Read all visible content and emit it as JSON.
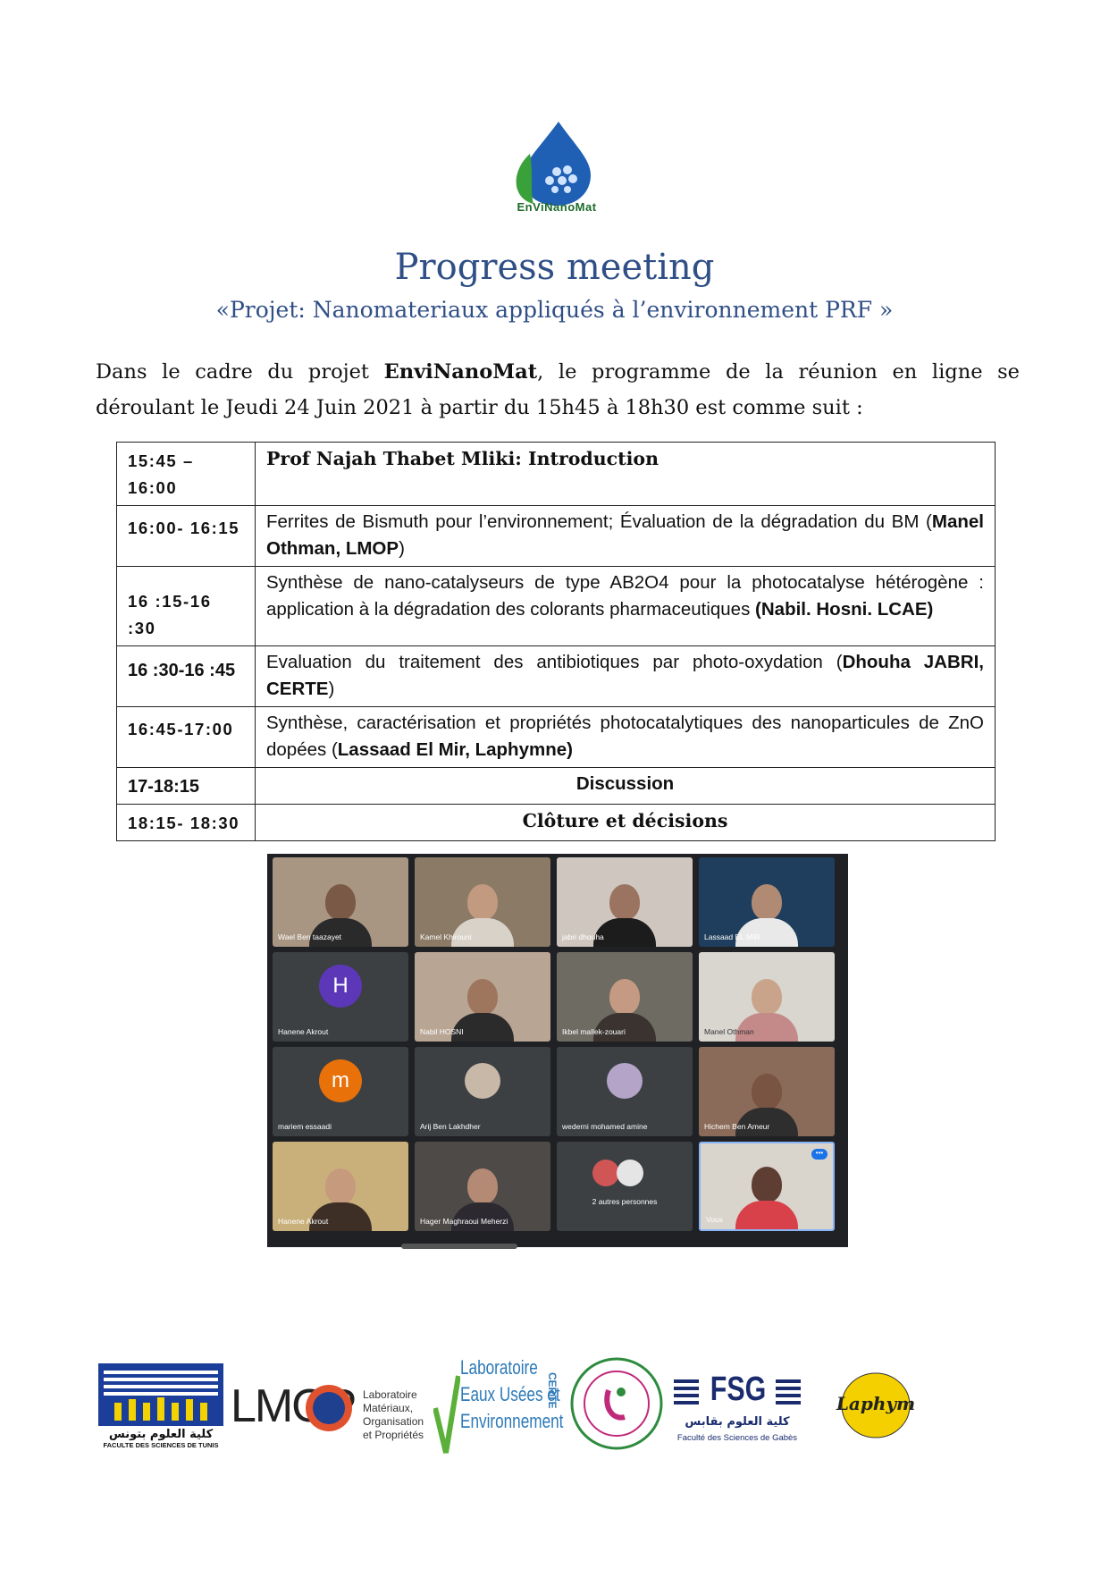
{
  "logo": {
    "wordmark": "EnViNanoMat",
    "colors": {
      "drop": "#1f5fb4",
      "leaf": "#3aa03a"
    }
  },
  "title": "Progress meeting",
  "subtitle": "«Projet: Nanomateriaux appliqués à l’environnement PRF »",
  "intro": {
    "part1": "Dans le cadre du projet ",
    "project": "EnviNanoMat",
    "part2": ", le programme de la réunion  en ligne se",
    "line2": "déroulant le Jeudi 24 Juin 2021 à partir du 15h45 à 18h30 est comme suit :"
  },
  "program": [
    {
      "time": "15:45 – 16:00",
      "title": "Prof Najah Thabet Mliki: Introduction"
    },
    {
      "time": "16:00- 16:15",
      "text": "Ferrites de Bismuth pour l’environnement; Évaluation de la dégradation du BM (",
      "speaker": "Manel Othman, LMOP",
      "end": ")"
    },
    {
      "time": "16 :15-16 :30",
      "text": "Synthèse de nano-catalyseurs de type AB2O4 pour la photocatalyse hétérogène : application à la dégradation des colorants pharmaceutiques ",
      "speaker": "(Nabil. Hosni. LCAE)",
      "end": ""
    },
    {
      "time": "16 :30-16 :45",
      "text": "Evaluation du traitement des antibiotiques par photo-oxydation (",
      "speaker": "Dhouha JABRI, CERTE",
      "end": ")"
    },
    {
      "time": "16:45-17:00",
      "text": "Synthèse, caractérisation et propriétés photocatalytiques des nanoparticules de ZnO dopées (",
      "speaker": "Lassaad El Mir, Laphymne)",
      "end": ""
    },
    {
      "time": "17-18:15",
      "center": "Discussion"
    },
    {
      "time": "18:15- 18:30",
      "center": "Clôture et décisions"
    }
  ],
  "meeting": {
    "participants": [
      "Wael Ben taazayet",
      "Kamel Khirouni",
      "jabri dhouha",
      "Lassaad EL MIR",
      "Hanene Akrout",
      "Nabil HOSNI",
      "Ikbel mallek-zouari",
      "Manel Othman",
      "mariem essaadi",
      "Arij Ben Lakhdher",
      "wederni mohamed amine",
      "Hichem Ben Ameur",
      "Hanene Akrout",
      "Hager Maghraoui Meherzi",
      "2 autres personnes",
      "Vous"
    ],
    "avatar_letters": {
      "hanene": "H",
      "mariem": "m"
    },
    "colors": {
      "hanene_avatar": "#5c37b8",
      "mariem_avatar": "#e8710a",
      "tile_bg": "#3c4043"
    }
  },
  "partners": {
    "fst_arabic": "كلية العلوم بتونس",
    "fst_text": "FACULTE DES SCIENCES DE TUNIS",
    "lmop": "LMOP",
    "lmop_desc": [
      "Laboratoire",
      "Matériaux,",
      "Organisation",
      "et Propriétés"
    ],
    "leue": [
      "Laboratoire",
      "Eaux Usées et",
      "Environnement"
    ],
    "certe": "CERTE",
    "fsg": "FSG",
    "fsg_arabic": "كلية العلوم بقابس",
    "fsg_text": "Faculté des Sciences de Gabès",
    "laphy": "Laphym"
  }
}
